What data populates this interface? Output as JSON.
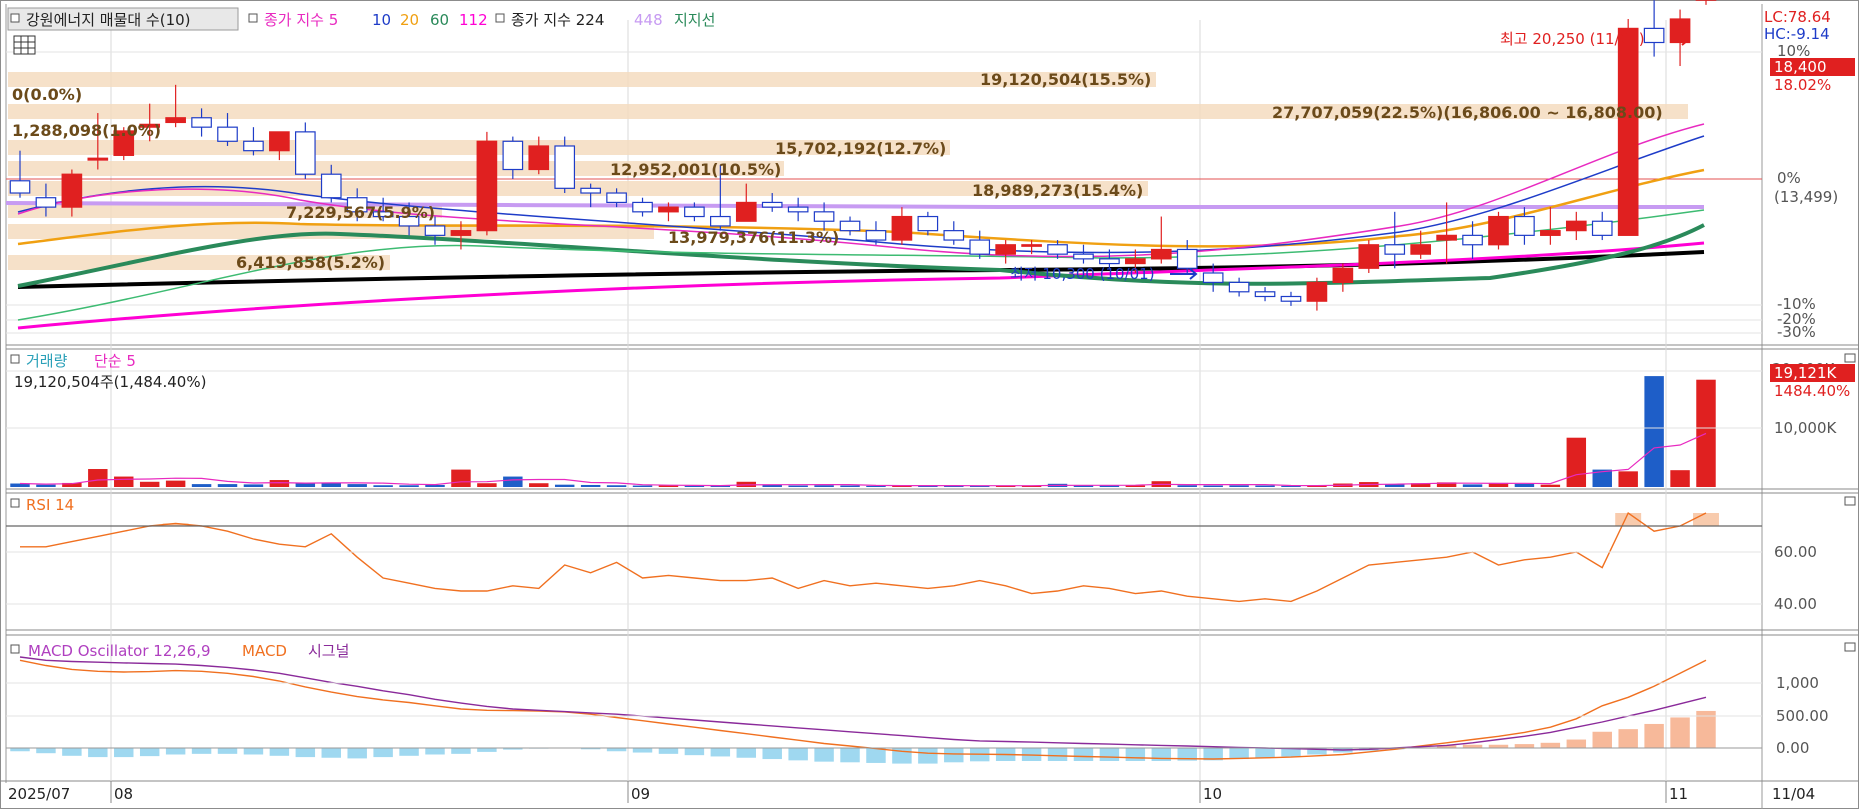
{
  "price_legend": {
    "stock": "강원에너지 매물대 수(10)",
    "ma_prefix": "종가 지수 5",
    "ma_periods": [
      "10",
      "20",
      "60",
      "112"
    ],
    "ma2_prefix": "종가 지수 224",
    "extra_period": "448",
    "support_label": "지지선"
  },
  "price_right": {
    "lc": "LC:78.64",
    "hc": "HC:-9.14",
    "pct10": "10%",
    "current": "18,400",
    "current_pct": "18.02%",
    "zero_pct": "0%",
    "ref_price": "(13,499)",
    "neg10": "-10%",
    "neg20": "-20%",
    "neg30": "-30%"
  },
  "annotations": {
    "high": "최고 20,250 (11/04)",
    "low": "최저 10,300 (10/01)"
  },
  "profile_labels": [
    "19,120,504(15.5%)",
    "0(0.0%)",
    "27,707,059(22.5%)(16,806.00 ~ 16,808.00)",
    "1,288,098(1.0%)",
    "15,702,192(12.7%)",
    "12,952,001(10.5%)",
    "18,989,273(15.4%)",
    "7,229,567(5.9%)",
    "13,979,376(11.3%)",
    "6,419,858(5.2%)"
  ],
  "volume_panel": {
    "title": "거래량",
    "ma": "단순 5",
    "info": "19,120,504주(1,484.40%)",
    "right_current": "19,121K",
    "right_pct": "1484.40%",
    "tick_top": "20,000K",
    "tick_mid": "10,000K"
  },
  "rsi_panel": {
    "title": "RSI 14",
    "tick_60": "60.00",
    "tick_40": "40.00"
  },
  "macd_panel": {
    "title_osc": "MACD Oscillator 12,26,9",
    "title_macd": "MACD",
    "title_signal": "시그널",
    "tick_1000": "1,000",
    "tick_500": "500.00",
    "tick_0": "0.00"
  },
  "x_axis": {
    "start": "2025/07",
    "m08": "08",
    "m09": "09",
    "m10": "10",
    "m11": "11",
    "end": "11/04"
  },
  "chart_data": {
    "type": "candlestick",
    "x": [
      "07/28",
      "07/29",
      "07/30",
      "07/31",
      "08/01",
      "08/04",
      "08/05",
      "08/06",
      "08/07",
      "08/08",
      "08/11",
      "08/12",
      "08/13",
      "08/14",
      "08/18",
      "08/19",
      "08/20",
      "08/21",
      "08/22",
      "08/25",
      "08/26",
      "08/27",
      "08/28",
      "08/29",
      "09/01",
      "09/02",
      "09/03",
      "09/04",
      "09/05",
      "09/08",
      "09/09",
      "09/10",
      "09/11",
      "09/12",
      "09/15",
      "09/16",
      "09/17",
      "09/18",
      "09/19",
      "09/22",
      "09/23",
      "09/24",
      "09/25",
      "09/26",
      "09/29",
      "09/30",
      "10/01",
      "10/02",
      "10/10",
      "10/13",
      "10/14",
      "10/15",
      "10/16",
      "10/17",
      "10/20",
      "10/21",
      "10/22",
      "10/23",
      "10/24",
      "10/27",
      "10/28",
      "10/29",
      "10/30",
      "10/31",
      "11/03",
      "11/04"
    ],
    "ohlc": [
      [
        13480,
        13800,
        13300,
        13350
      ],
      [
        13300,
        13450,
        13100,
        13200
      ],
      [
        13200,
        13600,
        13100,
        13550
      ],
      [
        13700,
        14200,
        13600,
        13720
      ],
      [
        13750,
        14050,
        13700,
        14010
      ],
      [
        14050,
        14300,
        13900,
        14080
      ],
      [
        14100,
        14500,
        14050,
        14150
      ],
      [
        14150,
        14250,
        13950,
        14050
      ],
      [
        14050,
        14200,
        13850,
        13900
      ],
      [
        13900,
        14050,
        13750,
        13800
      ],
      [
        13800,
        14000,
        13700,
        14000
      ],
      [
        14000,
        14100,
        13500,
        13550
      ],
      [
        13550,
        13650,
        13250,
        13300
      ],
      [
        13300,
        13400,
        13050,
        13150
      ],
      [
        13150,
        13300,
        13050,
        13100
      ],
      [
        13100,
        13250,
        12900,
        13000
      ],
      [
        13000,
        13100,
        12800,
        12900
      ],
      [
        12900,
        13050,
        12750,
        12950
      ],
      [
        12950,
        14000,
        12900,
        13900
      ],
      [
        13900,
        13950,
        13500,
        13600
      ],
      [
        13600,
        13950,
        13550,
        13850
      ],
      [
        13850,
        13950,
        13350,
        13400
      ],
      [
        13400,
        13450,
        13200,
        13350
      ],
      [
        13350,
        13400,
        13200,
        13250
      ],
      [
        13250,
        13300,
        13100,
        13150
      ],
      [
        13150,
        13250,
        13050,
        13200
      ],
      [
        13200,
        13250,
        13050,
        13100
      ],
      [
        13100,
        13650,
        12950,
        13000
      ],
      [
        13050,
        13450,
        13050,
        13250
      ],
      [
        13250,
        13350,
        13150,
        13200
      ],
      [
        13200,
        13300,
        13050,
        13150
      ],
      [
        13150,
        13250,
        12950,
        13050
      ],
      [
        13050,
        13100,
        12900,
        12950
      ],
      [
        12950,
        13050,
        12800,
        12850
      ],
      [
        12850,
        13200,
        12800,
        13100
      ],
      [
        13100,
        13150,
        12900,
        12950
      ],
      [
        12950,
        13050,
        12800,
        12850
      ],
      [
        12850,
        12950,
        12650,
        12700
      ],
      [
        12700,
        12850,
        12600,
        12800
      ],
      [
        12800,
        12850,
        12700,
        12800
      ],
      [
        12800,
        12850,
        12650,
        12700
      ],
      [
        12700,
        12800,
        12600,
        12650
      ],
      [
        12650,
        12750,
        12550,
        12600
      ],
      [
        12600,
        12750,
        12500,
        12650
      ],
      [
        12650,
        13100,
        12600,
        12750
      ],
      [
        12750,
        12850,
        12500,
        12550
      ],
      [
        12500,
        12600,
        12300,
        12400
      ],
      [
        12400,
        12450,
        12250,
        12300
      ],
      [
        12300,
        12350,
        12200,
        12250
      ],
      [
        12250,
        12300,
        12150,
        12200
      ],
      [
        12200,
        12450,
        12100,
        12400
      ],
      [
        12400,
        12600,
        12300,
        12550
      ],
      [
        12550,
        12850,
        12500,
        12800
      ],
      [
        12800,
        13150,
        12550,
        12700
      ],
      [
        12700,
        12950,
        12650,
        12800
      ],
      [
        12850,
        13250,
        12600,
        12900
      ],
      [
        12900,
        13050,
        12650,
        12800
      ],
      [
        12800,
        13150,
        12750,
        13100
      ],
      [
        13100,
        13200,
        12800,
        12900
      ],
      [
        12900,
        13200,
        12800,
        12950
      ],
      [
        12950,
        13150,
        12850,
        13050
      ],
      [
        13050,
        13150,
        12850,
        12900
      ],
      [
        12900,
        15200,
        12900,
        15100
      ],
      [
        15100,
        15400,
        14800,
        14950
      ],
      [
        14950,
        15300,
        14700,
        15200
      ],
      [
        15400,
        20250,
        15350,
        18400
      ]
    ],
    "volume_thousands": [
      600,
      400,
      700,
      3100,
      1800,
      900,
      1100,
      500,
      500,
      450,
      1200,
      700,
      650,
      500,
      300,
      300,
      350,
      3000,
      650,
      1800,
      650,
      400,
      350,
      300,
      250,
      250,
      200,
      250,
      900,
      350,
      250,
      300,
      250,
      200,
      250,
      250,
      250,
      200,
      200,
      200,
      550,
      300,
      250,
      250,
      1000,
      300,
      250,
      280,
      250,
      200,
      250,
      600,
      850,
      500,
      650,
      800,
      450,
      700,
      550,
      400,
      8500,
      3000,
      2700,
      19121,
      2900,
      18500
    ],
    "rsi": [
      62,
      62,
      64,
      66,
      68,
      70,
      71,
      70,
      68,
      65,
      63,
      62,
      67,
      58,
      50,
      48,
      46,
      45,
      45,
      47,
      46,
      55,
      52,
      56,
      50,
      51,
      50,
      49,
      49,
      50,
      46,
      49,
      47,
      48,
      47,
      46,
      47,
      49,
      47,
      44,
      45,
      47,
      46,
      44,
      45,
      43,
      42,
      41,
      42,
      41,
      45,
      50,
      55,
      56,
      57,
      58,
      60,
      55,
      57,
      58,
      60,
      54,
      75,
      68,
      70,
      75
    ],
    "rsi_ylim": [
      27,
      80
    ],
    "macd": [
      1350,
      1270,
      1210,
      1180,
      1170,
      1175,
      1190,
      1180,
      1150,
      1100,
      1030,
      940,
      860,
      790,
      740,
      700,
      650,
      600,
      580,
      575,
      570,
      555,
      520,
      470,
      420,
      370,
      320,
      270,
      220,
      170,
      120,
      70,
      30,
      -10,
      -50,
      -80,
      -90,
      -95,
      -100,
      -110,
      -120,
      -130,
      -140,
      -150,
      -160,
      -165,
      -170,
      -160,
      -150,
      -140,
      -120,
      -100,
      -60,
      -20,
      30,
      80,
      130,
      180,
      240,
      320,
      450,
      650,
      780,
      950,
      1150,
      1350
    ],
    "signal": [
      1400,
      1350,
      1330,
      1320,
      1310,
      1300,
      1290,
      1270,
      1240,
      1200,
      1150,
      1080,
      1010,
      950,
      880,
      820,
      750,
      690,
      640,
      600,
      580,
      560,
      540,
      520,
      490,
      460,
      430,
      400,
      370,
      340,
      310,
      280,
      250,
      220,
      190,
      160,
      130,
      110,
      100,
      90,
      80,
      70,
      60,
      50,
      40,
      30,
      20,
      10,
      0,
      -10,
      -20,
      -30,
      -20,
      0,
      20,
      40,
      80,
      130,
      180,
      240,
      320,
      400,
      490,
      580,
      680,
      780
    ],
    "oscillator": [
      -50,
      -80,
      -120,
      -140,
      -140,
      -125,
      -100,
      -90,
      -90,
      -100,
      -120,
      -140,
      -150,
      -160,
      -140,
      -120,
      -100,
      -90,
      -60,
      -25,
      -10,
      -5,
      -20,
      -50,
      -70,
      -90,
      -110,
      -130,
      -150,
      -170,
      -190,
      -210,
      -220,
      -230,
      -240,
      -240,
      -220,
      -205,
      -200,
      -200,
      -200,
      -200,
      -200,
      -200,
      -200,
      -195,
      -190,
      -170,
      -150,
      -130,
      -100,
      -70,
      -40,
      -20,
      10,
      40,
      50,
      50,
      60,
      80,
      130,
      250,
      290,
      370,
      470,
      570
    ],
    "macd_ylim": [
      -700,
      1700
    ]
  }
}
